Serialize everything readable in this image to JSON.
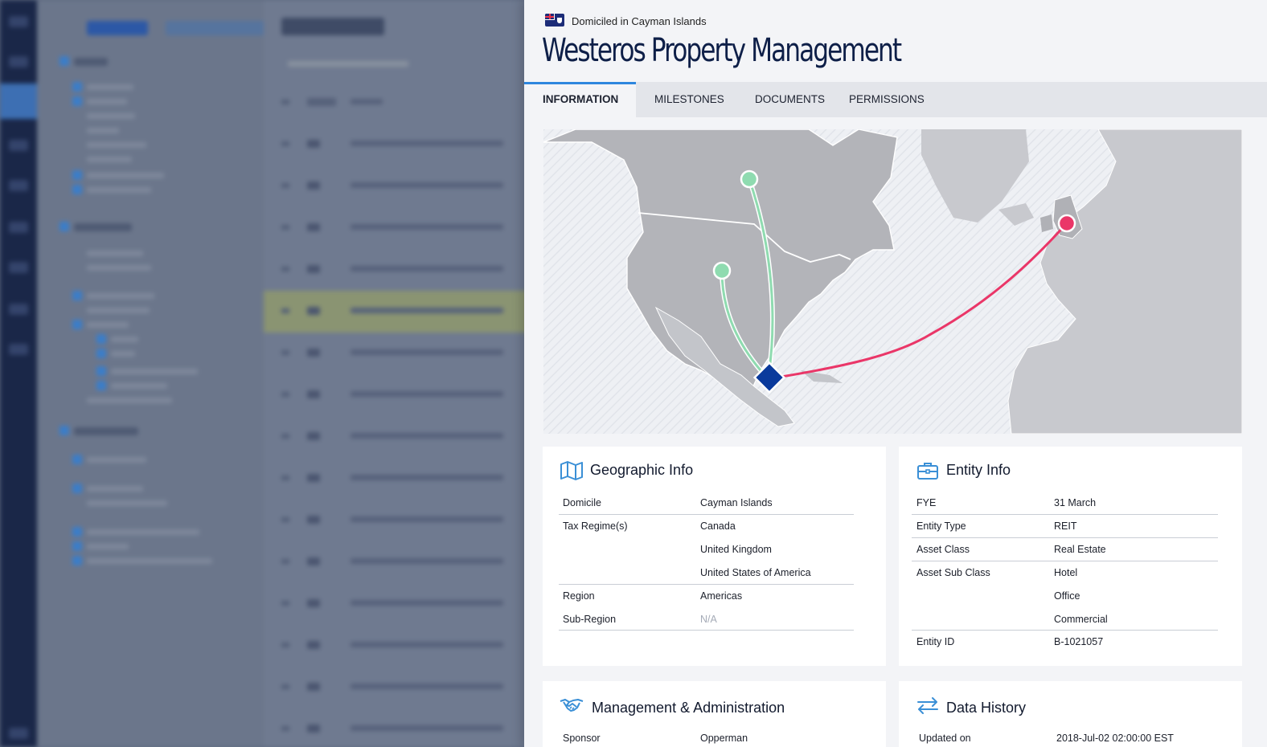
{
  "header": {
    "domicile_text": "Domiciled in Cayman Islands",
    "title": "Westeros Property Management",
    "flag": "cayman-islands-flag"
  },
  "tabs": [
    {
      "label": "INFORMATION",
      "active": true
    },
    {
      "label": "MILESTONES",
      "active": false
    },
    {
      "label": "DOCUMENTS",
      "active": false
    },
    {
      "label": "PERMISSIONS",
      "active": false
    }
  ],
  "map": {
    "origin_marker": "diamond",
    "routes": [
      {
        "to": "north-marker",
        "color": "#8fdbb0"
      },
      {
        "to": "central-marker",
        "color": "#8fdbb0"
      },
      {
        "to": "uk-marker",
        "color": "#ea3668"
      }
    ],
    "colors": {
      "origin": "#0a3a9c",
      "green": "#8fdbb0",
      "red": "#ea3668",
      "land": "#b3b4b9"
    }
  },
  "geographic": {
    "title": "Geographic Info",
    "icon": "map-icon",
    "domicile_label": "Domicile",
    "domicile_value": "Cayman Islands",
    "tax_label": "Tax Regime(s)",
    "tax_values": [
      "Canada",
      "United Kingdom",
      "United States of America"
    ],
    "region_label": "Region",
    "region_value": "Americas",
    "subregion_label": "Sub-Region",
    "subregion_value": "N/A"
  },
  "entity": {
    "title": "Entity Info",
    "icon": "briefcase-icon",
    "fye_label": "FYE",
    "fye_value": "31 March",
    "type_label": "Entity Type",
    "type_value": "REIT",
    "asset_class_label": "Asset Class",
    "asset_class_value": "Real Estate",
    "asset_sub_label": "Asset Sub Class",
    "asset_sub_values": [
      "Hotel",
      "Office",
      "Commercial"
    ],
    "id_label": "Entity ID",
    "id_value": "B-1021057"
  },
  "management": {
    "title": "Management & Administration",
    "icon": "handshake-icon",
    "sponsor_label": "Sponsor",
    "sponsor_value": "Opperman"
  },
  "history": {
    "title": "Data History",
    "icon": "arrows-icon",
    "updated_label": "Updated on",
    "updated_value": "2018-Jul-02 02:00:00 EST"
  }
}
